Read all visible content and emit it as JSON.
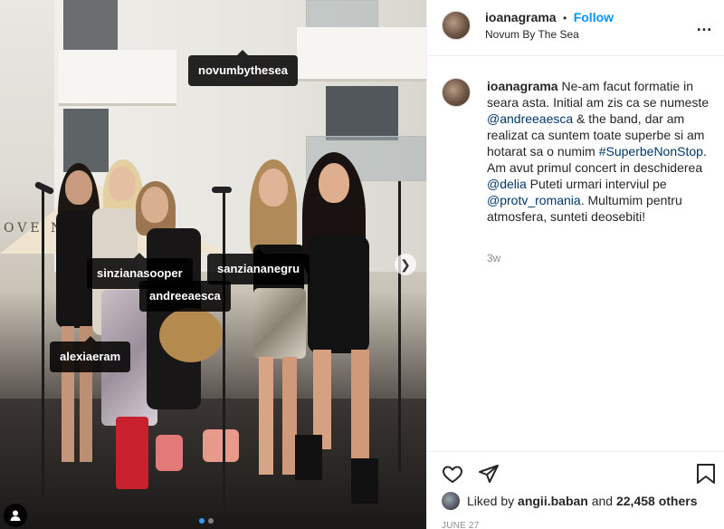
{
  "post": {
    "author": "ioanagrama",
    "follow_label": "Follow",
    "separator": "•",
    "location": "Novum By The Sea",
    "more_icon": "more-horizontal-icon",
    "caption_segments": [
      {
        "text": "Ne-am facut formatie in seara asta. Initial am zis ca se numeste ",
        "link": false
      },
      {
        "text": "@andreeaesca",
        "link": true
      },
      {
        "text": " & the band, dar am realizat ca suntem toate superbe si am hotarat sa o numim ",
        "link": false
      },
      {
        "text": "#SuperbeNonStop",
        "link": true
      },
      {
        "text": ". Am avut primul concert in deschiderea ",
        "link": false
      },
      {
        "text": "@delia",
        "link": true
      },
      {
        "text": " Puteti urmari interviul pe ",
        "link": false
      },
      {
        "text": "@protv_romania",
        "link": true
      },
      {
        "text": ". Multumim pentru atmosfera, sunteti deosebiti!",
        "link": false
      }
    ],
    "time_ago": "3w",
    "liked_by_prefix": "Liked by",
    "liked_by_user": "angii.baban",
    "liked_by_and": "and",
    "likes_others": "22,458 others",
    "date": "JUNE 27"
  },
  "photo": {
    "sign_text": "OVE    N DEP",
    "tags": [
      {
        "label": "novumbythesea"
      },
      {
        "label": "sinzianasooper"
      },
      {
        "label": "sanziananegru"
      },
      {
        "label": "andreeaesca"
      },
      {
        "label": "alexiaeram"
      }
    ],
    "carousel": {
      "count": 2,
      "active": 0
    },
    "next_icon": "chevron-right-icon"
  },
  "colors": {
    "accent": "#0095f6",
    "link": "#00376b",
    "muted": "#8e8e8e",
    "text": "#262626",
    "tag_bg": "#000000"
  }
}
